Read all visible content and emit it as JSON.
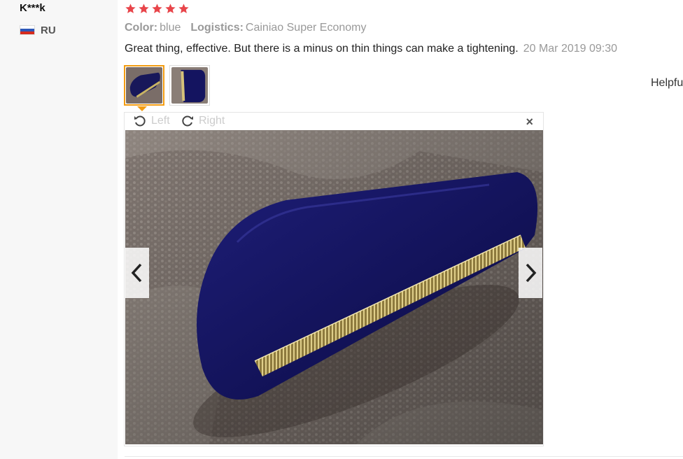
{
  "reviewer": {
    "name": "K***k",
    "country": "RU",
    "flag_icon": "russia-flag-icon"
  },
  "rating": {
    "stars": 5,
    "max": 5,
    "color": "#e8454a"
  },
  "meta": {
    "color_label": "Color:",
    "color_value": "blue",
    "logistics_label": "Logistics:",
    "logistics_value": "Cainiao Super Economy"
  },
  "review": {
    "text": "Great thing, effective. But there is a minus on thin things can make a tightening.",
    "date": "20 Mar 2019 09:30"
  },
  "thumbnails": [
    {
      "name": "review-photo-1",
      "active": true
    },
    {
      "name": "review-photo-2",
      "active": false
    }
  ],
  "helpful_label": "Helpfu",
  "viewer": {
    "rotate_left_label": "Left",
    "rotate_right_label": "Right",
    "close_symbol": "×",
    "icons": {
      "rotate_left": "rotate-left-icon",
      "rotate_right": "rotate-right-icon",
      "prev": "chevron-left-icon",
      "next": "chevron-right-icon",
      "close": "close-icon"
    }
  },
  "colors": {
    "accent": "#f39c12",
    "muted_text": "#999999",
    "star": "#e8454a"
  }
}
